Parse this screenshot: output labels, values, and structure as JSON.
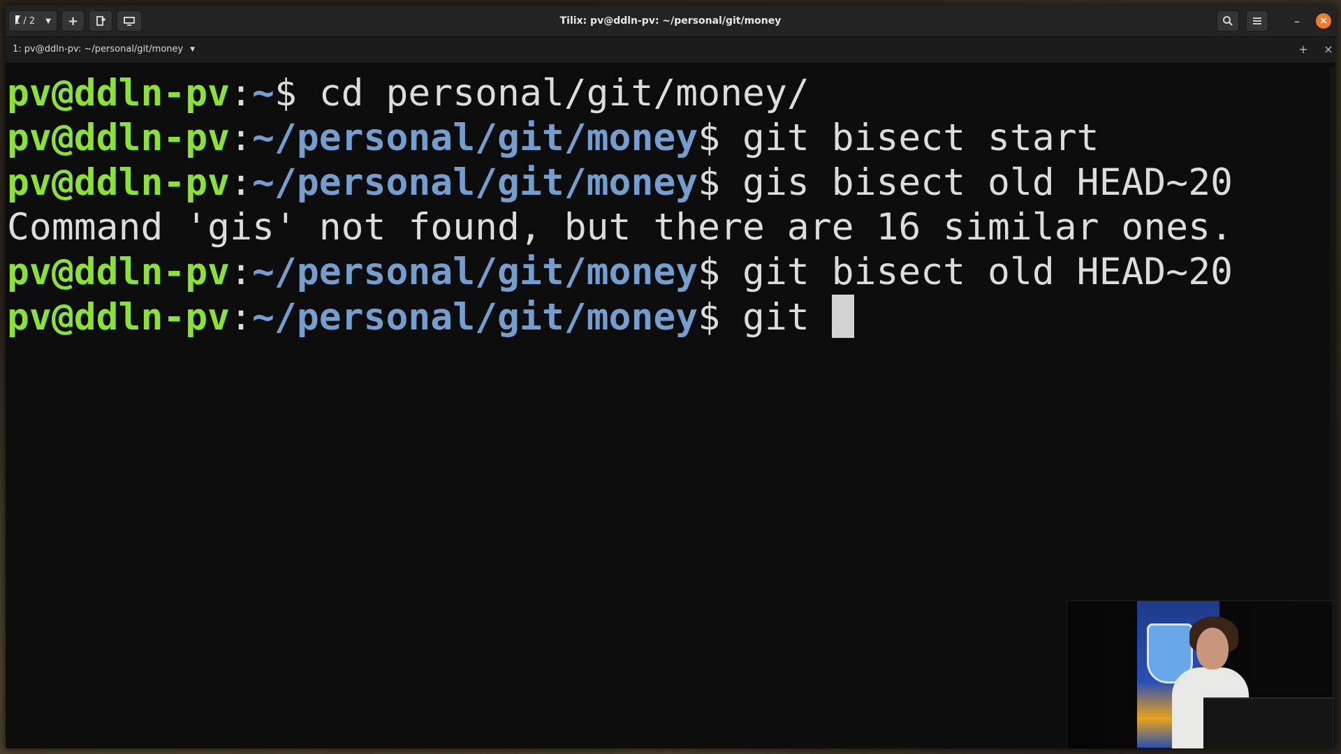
{
  "window": {
    "title": "Tilix: pv@ddln-pv: ~/personal/git/money"
  },
  "toolbar": {
    "session_indicator": "1 / 2",
    "add_label": "+",
    "session_dropdown_icon": "chevron-down-icon",
    "add_terminal_icon": "plus-icon",
    "split_icon": "split-terminal-icon",
    "sidebar_icon": "sessions-sidebar-icon",
    "search_icon": "search-icon",
    "menu_icon": "hamburger-menu-icon",
    "minimize_label": "–",
    "close_label": "×"
  },
  "tab": {
    "label": "1: pv@ddln-pv: ~/personal/git/money",
    "add_label": "+",
    "close_label": "×"
  },
  "terminal": {
    "lines": [
      {
        "user": "pv@ddln-pv",
        "path": "~",
        "command": " cd personal/git/money/"
      },
      {
        "user": "pv@ddln-pv",
        "path": "~/personal/git/money",
        "command": " git bisect start"
      },
      {
        "user": "pv@ddln-pv",
        "path": "~/personal/git/money",
        "command": " gis bisect old HEAD~20"
      },
      {
        "output": "Command 'gis' not found, but there are 16 similar ones."
      },
      {
        "user": "pv@ddln-pv",
        "path": "~/personal/git/money",
        "command": " git bisect old HEAD~20"
      },
      {
        "user": "pv@ddln-pv",
        "path": "~/personal/git/money",
        "command": " git "
      }
    ],
    "prompt_sep": ":",
    "prompt_end": "$"
  },
  "colors": {
    "user": "#8ae234",
    "path": "#729fcf",
    "text": "#dcdcdc",
    "close_button": "#f07b2e"
  }
}
